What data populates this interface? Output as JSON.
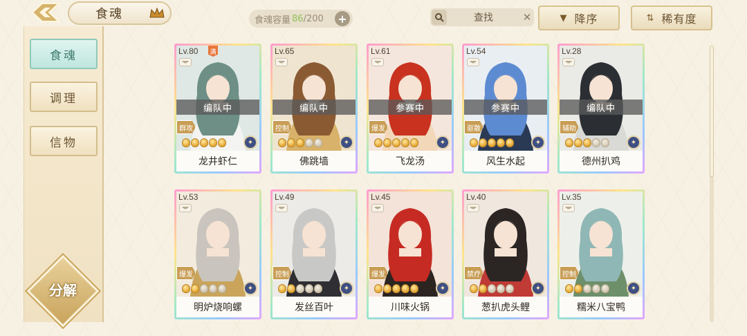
{
  "header": {
    "title": "食魂",
    "capacity_label": "食魂容量",
    "capacity_current": "86",
    "capacity_total": "/200",
    "capacity_add": "+",
    "search_placeholder": "查找",
    "search_clear": "✕",
    "sort_label": "降序",
    "rarity_label": "稀有度"
  },
  "sidebar": {
    "tabs": [
      {
        "label": "食魂",
        "active": true
      },
      {
        "label": "调理",
        "active": false
      },
      {
        "label": "信物",
        "active": false
      }
    ],
    "decompose_label": "分解"
  },
  "cards": [
    {
      "level": "Lv.80",
      "max": "满",
      "status": "编队中",
      "role": "群攻",
      "stars": 5,
      "name": "龙井虾仁",
      "colors": [
        "#dfe8e4",
        "#6d8f86",
        "#f3f4f1"
      ]
    },
    {
      "level": "Lv.65",
      "max": "",
      "status": "编队中",
      "role": "控制",
      "stars": 3,
      "name": "佛跳墙",
      "colors": [
        "#efe4cf",
        "#8a5a33",
        "#d8b26a"
      ]
    },
    {
      "level": "Lv.61",
      "max": "",
      "status": "参赛中",
      "role": "爆发",
      "stars": 5,
      "name": "飞龙汤",
      "colors": [
        "#f4e6dd",
        "#c8321f",
        "#f2d7b9"
      ]
    },
    {
      "level": "Lv.54",
      "max": "",
      "status": "参赛中",
      "role": "驱散",
      "stars": 5,
      "name": "风生水起",
      "colors": [
        "#e9eef3",
        "#5d8bd1",
        "#2a3a55"
      ]
    },
    {
      "level": "Lv.28",
      "max": "",
      "status": "编队中",
      "role": "辅助",
      "stars": 3,
      "name": "德州扒鸡",
      "colors": [
        "#eaeae6",
        "#2b2f33",
        "#d9dad6"
      ]
    },
    {
      "level": "Lv.53",
      "max": "",
      "status": "",
      "role": "爆发",
      "stars": 2,
      "name": "明炉烧响螺",
      "colors": [
        "#f2ebde",
        "#c9c4bd",
        "#c9a45a"
      ]
    },
    {
      "level": "Lv.49",
      "max": "",
      "status": "",
      "role": "控制",
      "stars": 2,
      "name": "发丝百叶",
      "colors": [
        "#ecebe8",
        "#c8c8c6",
        "#2e2e33"
      ]
    },
    {
      "level": "Lv.45",
      "max": "",
      "status": "",
      "role": "爆发",
      "stars": 5,
      "name": "川味火锅",
      "colors": [
        "#f3e3d9",
        "#c62b23",
        "#2c2420"
      ]
    },
    {
      "level": "Lv.40",
      "max": "",
      "status": "",
      "role": "禁疗",
      "stars": 2,
      "name": "葱扒虎头鲤",
      "colors": [
        "#f0e7df",
        "#2b2624",
        "#c03a36"
      ]
    },
    {
      "level": "Lv.35",
      "max": "",
      "status": "",
      "role": "控制",
      "stars": 2,
      "name": "糯米八宝鸭",
      "colors": [
        "#edf0ea",
        "#8fb7b5",
        "#6d8f6a"
      ]
    }
  ]
}
